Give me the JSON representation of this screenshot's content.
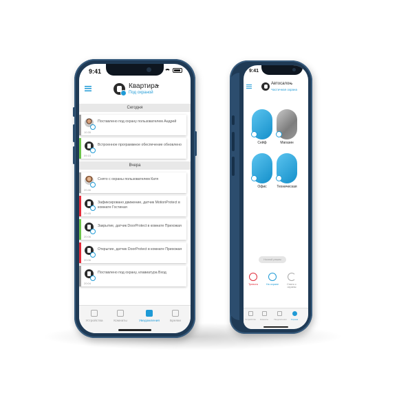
{
  "phone_a": {
    "status_time": "9:41",
    "header": {
      "title": "Квартира",
      "subtitle": "Под охраной"
    },
    "sections": [
      {
        "label": "Сегодня",
        "items": [
          {
            "text": "Поставлено под охрану пользователем Андрей",
            "time": "10:35",
            "kind": "person",
            "accent": "grey"
          },
          {
            "text": "Встроенное программное обеспечение обновлено",
            "time": "09:15",
            "kind": "device",
            "accent": "green"
          }
        ]
      },
      {
        "label": "Вчера",
        "items": [
          {
            "text": "Снято с охраны пользователем Катя",
            "time": "20:46",
            "kind": "person2",
            "accent": "grey"
          },
          {
            "text": "Зафиксировано движение, датчик MotionProtect в комнате Гостиная",
            "time": "20:45",
            "kind": "device",
            "accent": "red"
          },
          {
            "text": "Закрытие, датчик DoorProtect в комнате Прихожая",
            "time": "20:06",
            "kind": "device",
            "accent": "green"
          },
          {
            "text": "Открытие, датчик DoorProtect в комнате Прихожая",
            "time": "20:06",
            "kind": "device",
            "accent": "red"
          },
          {
            "text": "Поставлено под охрану, клавиатура Вход",
            "time": "20:04",
            "kind": "device",
            "accent": "grey"
          }
        ]
      }
    ],
    "tabs": [
      {
        "label": "Устройства",
        "active": false
      },
      {
        "label": "Комнаты",
        "active": false
      },
      {
        "label": "Уведомления",
        "active": true
      },
      {
        "label": "Брелки",
        "active": false
      }
    ]
  },
  "phone_b": {
    "status_time": "9:41",
    "header": {
      "title": "Автосалон",
      "subtitle": "Частичная охрана"
    },
    "rooms": [
      {
        "label": "Сейф",
        "style": "blue"
      },
      {
        "label": "Магазин",
        "style": "photo"
      },
      {
        "label": "Офис",
        "style": "blue"
      },
      {
        "label": "Техническая",
        "style": "blue"
      }
    ],
    "night_mode_label": "Ночной режим",
    "modes": [
      {
        "label": "Тревога",
        "style": "red"
      },
      {
        "label": "На охране",
        "style": "blue"
      },
      {
        "label": "Снято с охраны",
        "style": "grey"
      }
    ],
    "tabs": [
      {
        "label": "Устройства",
        "active": false
      },
      {
        "label": "Комнаты",
        "active": false
      },
      {
        "label": "Уведомления",
        "active": false
      },
      {
        "label": "Охрана",
        "active": true
      }
    ]
  },
  "colors": {
    "accent": "#1e9ad6",
    "alarm": "#e02b3a",
    "ok": "#6cc24a",
    "frame": "#1f3a55"
  }
}
